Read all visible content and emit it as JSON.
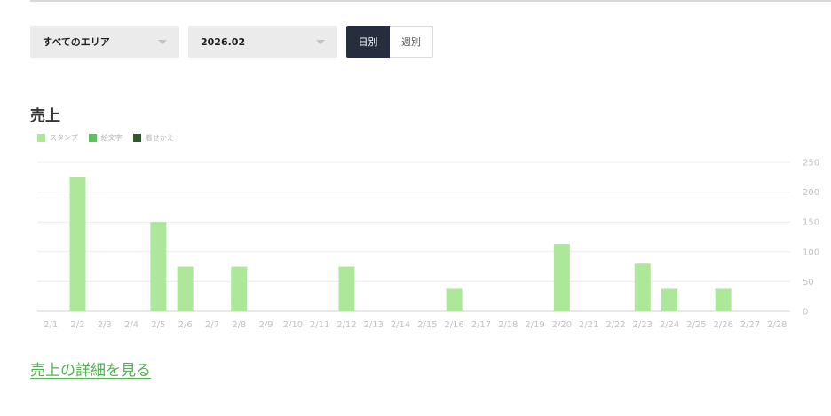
{
  "filters": {
    "area_select": {
      "value": "すべてのエリア"
    },
    "month_select": {
      "value": "2026.02"
    }
  },
  "period_toggle": {
    "daily_label": "日別",
    "weekly_label": "週別",
    "selected": "daily"
  },
  "sales": {
    "title": "売上",
    "detail_link_label": "売上の詳細を見る"
  },
  "legend": [
    {
      "label": "スタンプ",
      "color": "#ade79a"
    },
    {
      "label": "絵文字",
      "color": "#5cc25c"
    },
    {
      "label": "着せかえ",
      "color": "#2f5a2c"
    }
  ],
  "chart_data": {
    "type": "bar",
    "categories": [
      "2/1",
      "2/2",
      "2/3",
      "2/4",
      "2/5",
      "2/6",
      "2/7",
      "2/8",
      "2/9",
      "2/10",
      "2/11",
      "2/12",
      "2/13",
      "2/14",
      "2/15",
      "2/16",
      "2/17",
      "2/18",
      "2/19",
      "2/20",
      "2/21",
      "2/22",
      "2/23",
      "2/24",
      "2/25",
      "2/26",
      "2/27",
      "2/28"
    ],
    "series": [
      {
        "name": "スタンプ",
        "color": "#ade79a",
        "values": [
          0,
          225,
          0,
          0,
          150,
          75,
          0,
          75,
          0,
          0,
          0,
          75,
          0,
          0,
          0,
          38,
          0,
          0,
          0,
          113,
          0,
          0,
          80,
          38,
          0,
          38,
          0,
          0
        ]
      },
      {
        "name": "絵文字",
        "color": "#5cc25c",
        "values": [
          0,
          0,
          0,
          0,
          0,
          0,
          0,
          0,
          0,
          0,
          0,
          0,
          0,
          0,
          0,
          0,
          0,
          0,
          0,
          0,
          0,
          0,
          0,
          0,
          0,
          0,
          0,
          0
        ]
      },
      {
        "name": "着せかえ",
        "color": "#2f5a2c",
        "values": [
          0,
          0,
          0,
          0,
          0,
          0,
          0,
          0,
          0,
          0,
          0,
          0,
          0,
          0,
          0,
          0,
          0,
          0,
          0,
          0,
          0,
          0,
          0,
          0,
          0,
          0,
          0,
          0
        ]
      }
    ],
    "ylim": [
      0,
      250
    ],
    "yticks": [
      0,
      50,
      100,
      150,
      200,
      250
    ],
    "y_axis_side": "right",
    "grid": true,
    "stacked": true
  }
}
